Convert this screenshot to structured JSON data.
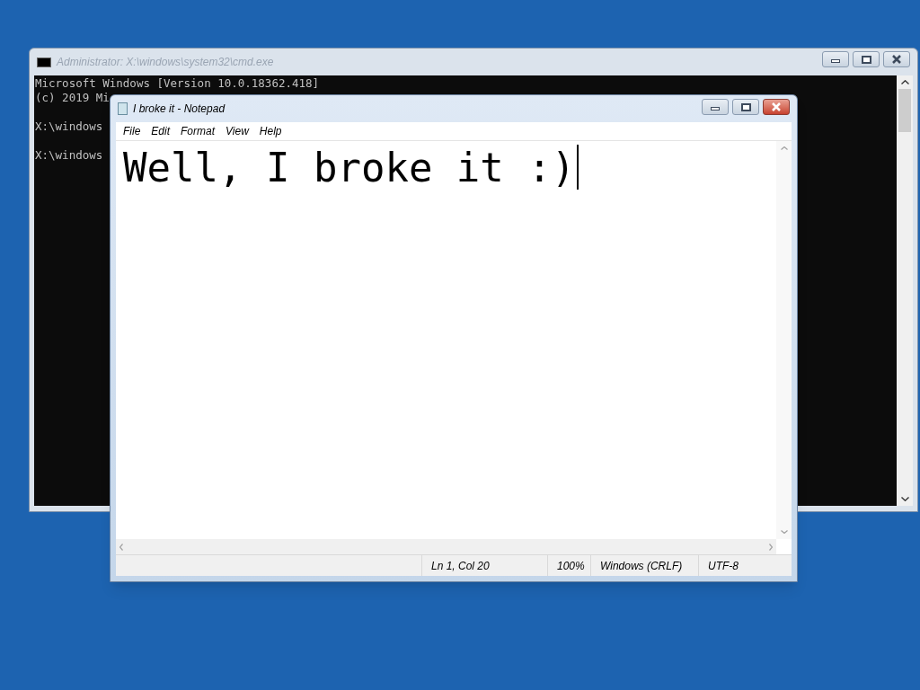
{
  "console_window": {
    "title": "Administrator: X:\\windows\\system32\\cmd.exe",
    "active": false,
    "paragraphs": [
      [
        "Microsoft Windows [Version 10.0.18362.418]",
        "(c) 2019 Mi"
      ],
      [
        "X:\\windows"
      ],
      [
        "X:\\windows"
      ]
    ]
  },
  "notepad_window": {
    "title": "I broke it - Notepad",
    "active": true,
    "menu": [
      "File",
      "Edit",
      "Format",
      "View",
      "Help"
    ],
    "text": "Well, I broke it :)",
    "status_bar": [
      "Ln 1, Col 20",
      "100%",
      "Windows (CRLF)",
      "UTF-8"
    ]
  }
}
